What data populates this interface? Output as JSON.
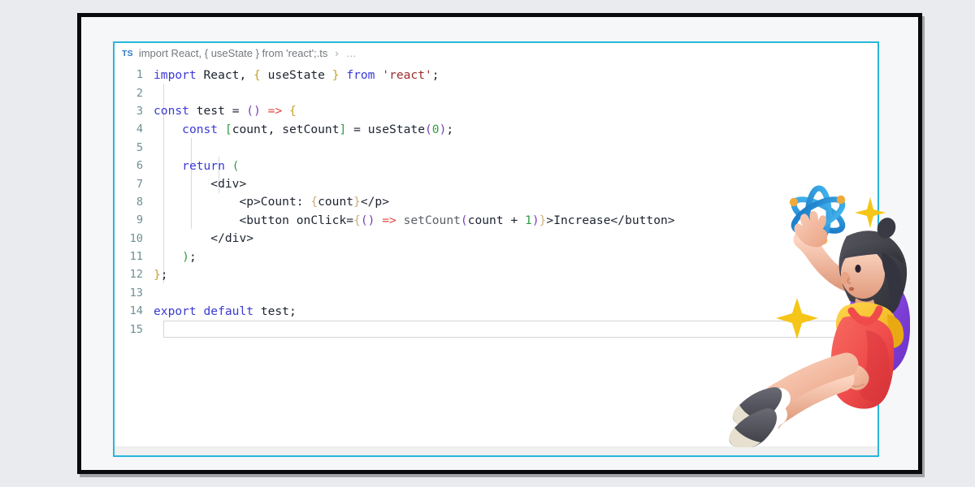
{
  "window": {
    "frame_style": "black-bordered-screenshot",
    "page_background": "#e9ebee",
    "panel_border_color": "#29b6dc",
    "panel_background": "#ffffff"
  },
  "breadcrumb": {
    "file_type_badge": "TS",
    "path_text": "import React, { useState } from 'react';.ts",
    "separator": "›",
    "overflow": "…"
  },
  "editor": {
    "language": "typescript",
    "total_lines": 15,
    "active_line": 15,
    "line_numbers": [
      "1",
      "2",
      "3",
      "4",
      "5",
      "6",
      "7",
      "8",
      "9",
      "10",
      "11",
      "12",
      "13",
      "14",
      "15"
    ],
    "lines": [
      "import React, { useState } from 'react';",
      "",
      "const test = () => {",
      "    const [count, setCount] = useState(0);",
      "",
      "    return (",
      "        <div>",
      "            <p>Count: {count}</p>",
      "            <button onClick={() => setCount(count + 1)}>Increase</button>",
      "        </div>",
      "    );",
      "};",
      "",
      "export default test;",
      ""
    ],
    "colors": {
      "keyword": "#3a3ad6",
      "string": "#9c2c2c",
      "number": "#2f9e44",
      "bracket_green": "#2f9e44",
      "bracket_purple": "#7b3fb5",
      "bracket_gold": "#c9a227",
      "arrow": "#e2453c",
      "identifier": "#1c2330",
      "line_number": "#6d8f91",
      "indent_guide": "#d8dade"
    }
  },
  "illustration": {
    "name": "student-with-atom",
    "description": "3D character: girl floating, reaching toward a blue atom symbol, with yellow sparkles",
    "colors": {
      "hair": "#3b3b42",
      "skin": "#f1b69a",
      "shirt": "#f5c518",
      "dress": "#ef4b4b",
      "backpack": "#7b3fd6",
      "shoe": "#4a4a52",
      "shoe_sole": "#e7e0cf",
      "sock": "#ffffff",
      "atom": "#2196d6",
      "atom_node": "#f0a93a",
      "sparkle": "#f5c518"
    },
    "elements": [
      "atom-icon",
      "sparkle-large",
      "sparkle-small",
      "character-figure"
    ]
  }
}
